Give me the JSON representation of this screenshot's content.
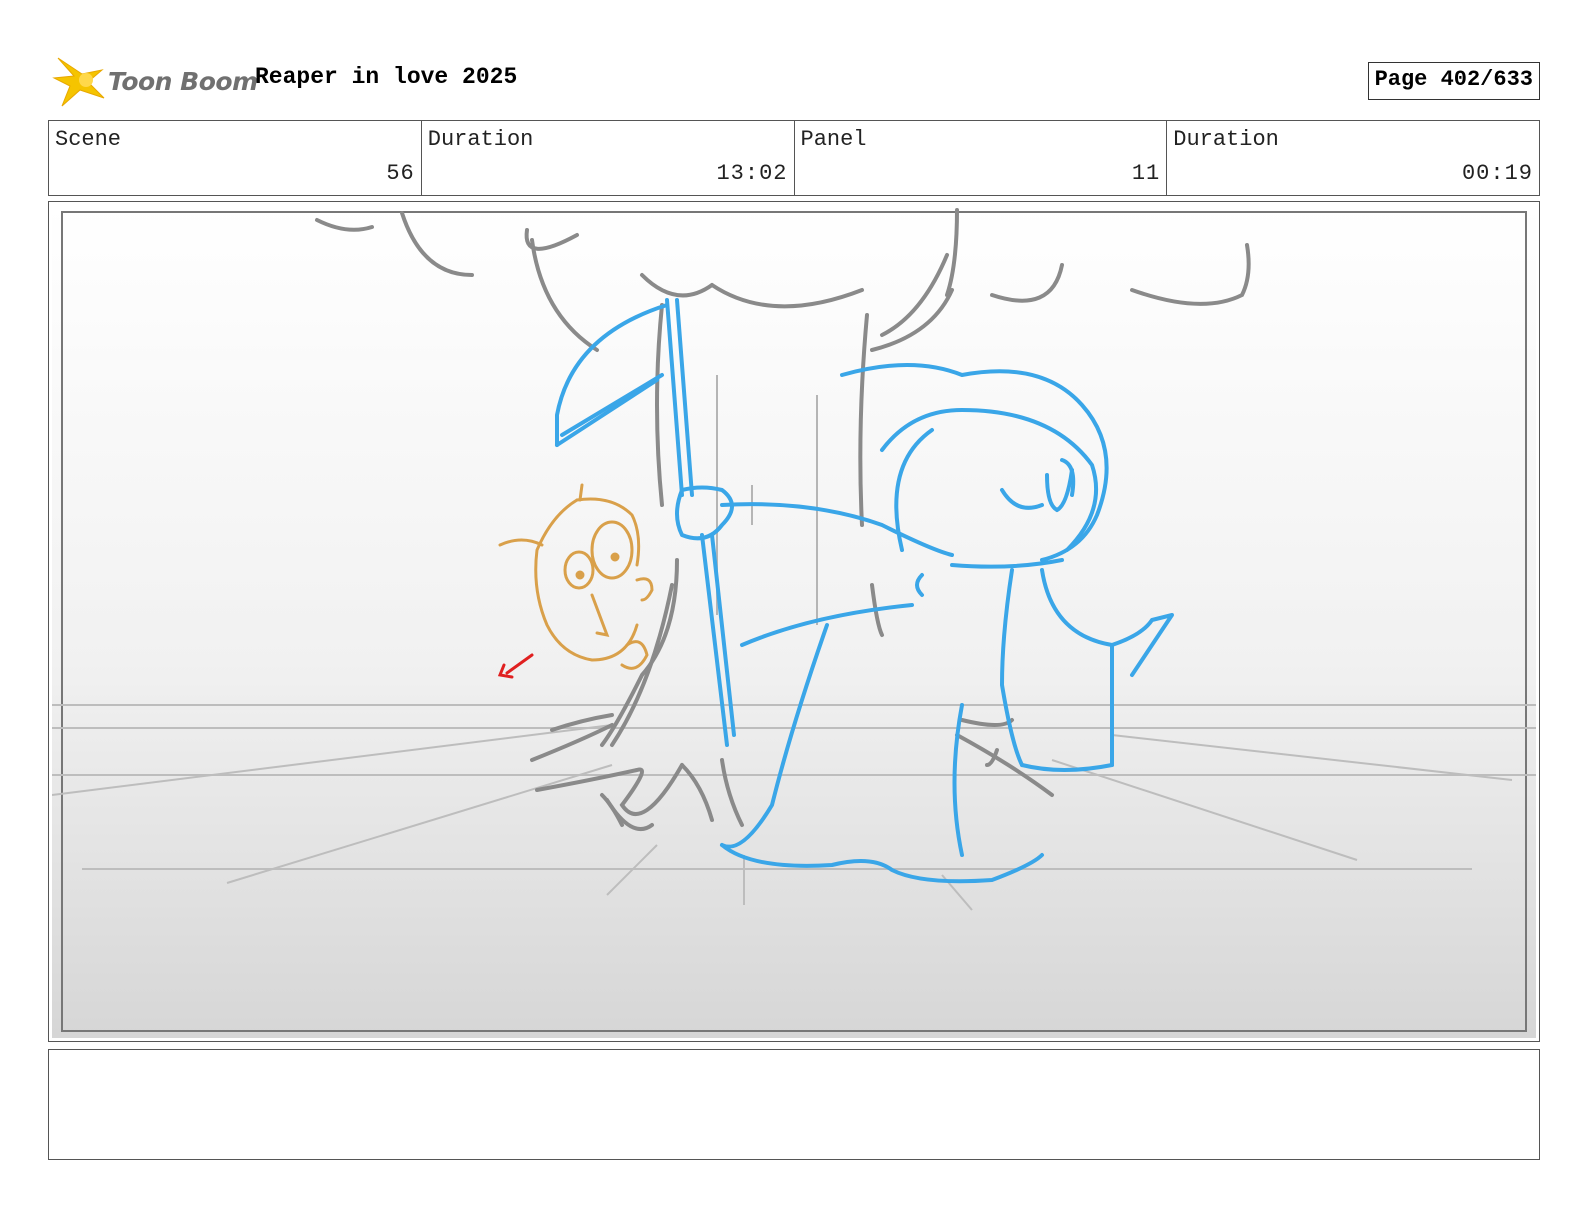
{
  "header": {
    "logo_text": "Toon Boom",
    "project_title": "Reaper in love 2025",
    "page_number": "Page 402/633"
  },
  "info": {
    "scene_label": "Scene",
    "scene_value": "56",
    "scene_duration_label": "Duration",
    "scene_duration_value": "13:02",
    "panel_label": "Panel",
    "panel_value": "11",
    "panel_duration_label": "Duration",
    "panel_duration_value": "00:19"
  },
  "colors": {
    "reaper_line": "#3aa6e8",
    "owl_line": "#d9a04a",
    "tree_line": "#8a8a8a",
    "arrow_line": "#e02020",
    "logo_star": "#f5c400"
  },
  "notes": {
    "text": ""
  }
}
